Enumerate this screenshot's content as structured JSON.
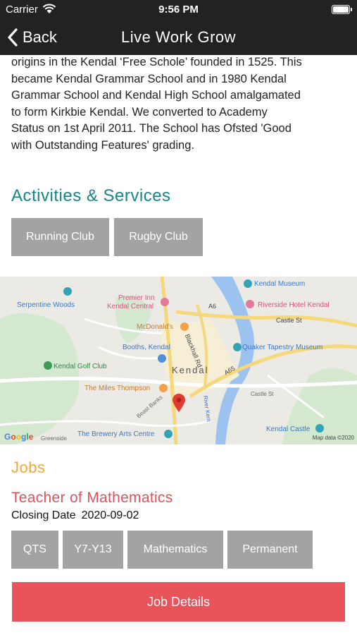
{
  "status_bar": {
    "carrier": "Carrier",
    "time": "9:56 PM"
  },
  "nav": {
    "back_label": "Back",
    "title": "Live Work Grow"
  },
  "intro": {
    "lines": [
      "origins in the Kendal ‘Free Schole’ founded in 1525. This",
      "became Kendal Grammar School and in 1980 Kendal",
      "Grammar School and Kendal High School amalgamated",
      "to form Kirkbie Kendal.  We converted to Academy",
      "Status on 1st April 2011.  The School has Ofsted 'Good",
      "with Outstanding Features' grading."
    ]
  },
  "activities": {
    "title": "Activities & Services",
    "items": [
      "Running Club",
      "Rugby Club"
    ]
  },
  "map": {
    "labels": {
      "kendal_museum": "Kendal Museum",
      "serpentine_woods": "Serpentine Woods",
      "premier_inn": "Premier Inn",
      "kendal_central": "Kendal Central",
      "riverside_hotel": "Riverside Hotel Kendal",
      "a6": "A6",
      "mcdonalds": "McDonald's",
      "castle_st": "Castle St",
      "blackhall_rd": "Blackhall Rd",
      "booths": "Booths, Kendal",
      "quaker": "Quaker Tapestry Museum",
      "golf_club": "Kendal Golf Club",
      "kendal_town": "Kendal",
      "a65": "A65",
      "miles_thompson": "The Miles Thompson",
      "river_kent": "River Kent",
      "kendal_castle": "Kendal Castle",
      "brewery": "The Brewery Arts Centre",
      "greenside": "Greenside",
      "beast_banks": "Beast Banks",
      "castle_street_small": "Castle St",
      "google": "Google",
      "copyright": "Map data ©2020"
    }
  },
  "jobs": {
    "title": "Jobs",
    "job_title": "Teacher of Mathematics",
    "closing_label": "Closing Date",
    "closing_value": "2020-09-02",
    "tags": [
      "QTS",
      "Y7-Y13",
      "Mathematics",
      "Permanent"
    ],
    "details_button": "Job Details"
  },
  "colors": {
    "nav_bg": "#222222",
    "activities_title": "#14868a",
    "jobs_title": "#f3a73a",
    "job_title": "#e0525a",
    "tag_bg": "#a3a3a3",
    "job_details_bg": "#e9545a"
  }
}
